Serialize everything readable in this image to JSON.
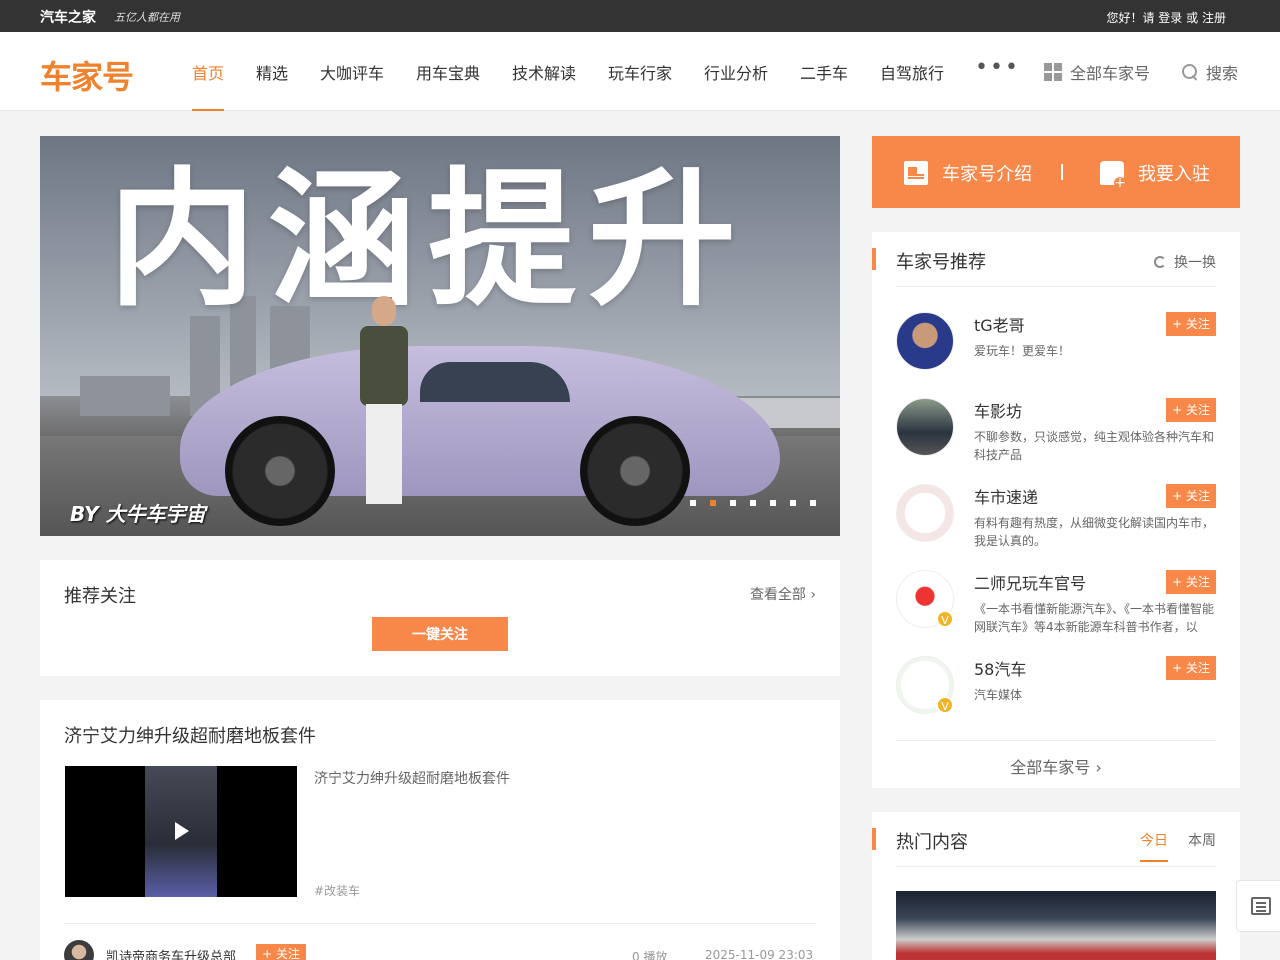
{
  "topbar": {
    "brand": "汽车之家",
    "slogan": "五亿人都在用",
    "greeting": "您好！请",
    "login": "登录",
    "or": "或",
    "register": "注册"
  },
  "nav": {
    "logo": "车家号",
    "items": [
      "首页",
      "精选",
      "大咖评车",
      "用车宝典",
      "技术解读",
      "玩车行家",
      "行业分析",
      "二手车",
      "自驾旅行"
    ],
    "more": "•••",
    "all_hao": "全部车家号",
    "search": "搜索"
  },
  "banner": {
    "headline": "内涵提升",
    "byline": "BY 大牛车宇宙",
    "slide_count": 7,
    "active_slide": 2
  },
  "recommend_follow": {
    "title": "推荐关注",
    "see_all": "查看全部",
    "follow_all": "一键关注"
  },
  "article": {
    "title": "济宁艾力绅升级超耐磨地板套件",
    "desc": "济宁艾力绅升级超耐磨地板套件",
    "tag": "#改装车",
    "author": "凯诗帝商务车升级总部",
    "follow": "+ 关注",
    "plays": "0 播放",
    "time": "2025-11-09 23:03"
  },
  "intro_bar": {
    "intro": "车家号介绍",
    "join": "我要入驻"
  },
  "rec_panel": {
    "title": "车家号推荐",
    "refresh": "换一换",
    "all_link": "全部车家号",
    "accounts": [
      {
        "name": "tG老哥",
        "bio": "爱玩车！更爱车！",
        "follow": "+ 关注"
      },
      {
        "name": "车影坊",
        "bio": "不聊参数，只谈感觉，纯主观体验各种汽车和科技产品",
        "follow": "+ 关注"
      },
      {
        "name": "车市速递",
        "bio": "有料有趣有热度，从细微变化解读国内车市，我是认真的。",
        "follow": "+ 关注"
      },
      {
        "name": "二师兄玩车官号",
        "bio": "《一本书看懂新能源汽车》、《一本书看懂智能网联汽车》等4本新能源车科普书作者，以",
        "follow": "+ 关注"
      },
      {
        "name": "58汽车",
        "bio": "汽车媒体",
        "follow": "+ 关注"
      }
    ]
  },
  "hot_panel": {
    "title": "热门内容",
    "tab_today": "今日",
    "tab_week": "本周"
  },
  "colors": {
    "accent": "#f0812d",
    "button": "#f7884a",
    "topbar": "#333333"
  }
}
